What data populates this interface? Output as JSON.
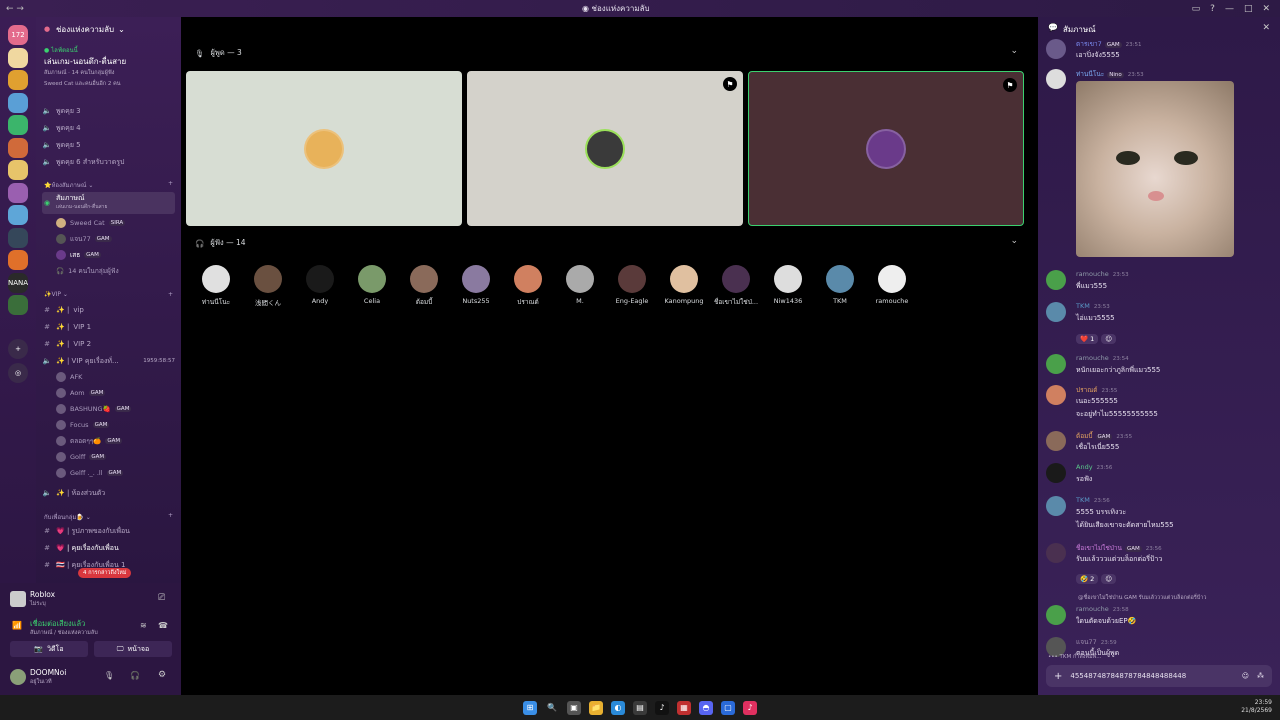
{
  "window": {
    "title": "ช่องแห่งความลับ",
    "nav": "← →",
    "controls": [
      "▭",
      "?",
      "—",
      "□",
      "✕"
    ]
  },
  "rail": {
    "servers": [
      {
        "label": "172",
        "color": "#e36b8c",
        "badge": "172"
      },
      {
        "label": "",
        "color": "#f0d8a0",
        "badge": ""
      },
      {
        "label": "",
        "color": "#e0a030",
        "badge": ""
      },
      {
        "label": "",
        "color": "#5a9fd6",
        "badge": "31"
      },
      {
        "label": "",
        "color": "#3bb56b",
        "badge": "69"
      },
      {
        "label": "",
        "color": "#d06a3a",
        "badge": "72"
      },
      {
        "label": "",
        "color": "#e7c46a",
        "badge": "24"
      },
      {
        "label": "",
        "color": "#9a5fb0",
        "badge": "4"
      },
      {
        "label": "",
        "color": "#5ea6d8",
        "badge": "1"
      },
      {
        "label": "",
        "color": "#35475a",
        "badge": "4"
      },
      {
        "label": "",
        "color": "#e0702a",
        "badge": ""
      },
      {
        "label": "NANA",
        "color": "#2a2a2a",
        "badge": ""
      },
      {
        "label": "",
        "color": "#3a6e3a",
        "badge": "96+"
      }
    ]
  },
  "sidebar": {
    "server_name": "ช่องแห่งความลับ",
    "event_label": "● ไลฟ์ตอนนี้",
    "event_title": "เล่นเกม-นอนดึก-ตื่นสาย",
    "event_sub1": "สัมภาษณ์ · 14 คนในกลุ่มผู้ฟัง",
    "event_sub2": "Sweed Cat และคนอื่นอีก 2 คน",
    "channels_top": [
      "พูดคุย 3",
      "พูดคุย 4",
      "พูดคุย 5",
      "พูดคุย 6 สำหรับวาดรูป"
    ],
    "cat_interview": "⭐ห้องสัมภาษณ์ ⌄",
    "stage_name": "สัมภาษณ์",
    "stage_sub": "เล่นเกม-นอนดึก-ตื่นสาย",
    "stage_users": [
      {
        "name": "Sweed Cat",
        "tag": "SIRA"
      },
      {
        "name": "แจน77",
        "tag": "GAM"
      },
      {
        "name": "เสธ",
        "tag": "GAM"
      }
    ],
    "audience_count": "14 คนในกลุ่มผู้ฟัง",
    "cat_vip": "✨VIP ⌄",
    "vip_channels": [
      "vip",
      "VIP 1",
      "VIP 2"
    ],
    "vip_voice": "✨ | VIP คุยเรื่องทั่...",
    "vip_timer": "1959:58:57",
    "vip_users": [
      {
        "name": "AFK",
        "tag": ""
      },
      {
        "name": "Aom",
        "tag": "GAM"
      },
      {
        "name": "BASHUNG🍓",
        "tag": "GAM"
      },
      {
        "name": "Focus",
        "tag": "GAM"
      },
      {
        "name": "ตลอดๆๆ🍊",
        "tag": "GAM"
      },
      {
        "name": "Golff",
        "tag": "GAM"
      },
      {
        "name": "Gelff ._. .ll",
        "tag": "GAM"
      }
    ],
    "private_room": "✨ | ห้องส่วนตัว",
    "cat_friends": "กับเพื่อนกลุ่ม🍺 ⌄",
    "friend_channels": [
      "💗 | รูปภาพของกับเพื่อน",
      "💗 | คุยเรื่องกับเพื่อน",
      "🇹🇭 | คุยเรื่องกับเพื่อน 1"
    ],
    "new_mentions": "4 การกล่าวถึงใหม่"
  },
  "user_panel": {
    "game": "Roblox",
    "game_sub": "ไม่ระบุ",
    "voice_status": "เชื่อมต่อเสียงแล้ว",
    "voice_sub": "สัมภาษณ์ / ช่องแห่งความลับ",
    "video_label": "วิดีโอ",
    "screen_label": "หน้าจอ",
    "username": "DOOMNoi",
    "user_status": "อยู่ในเวที"
  },
  "stage": {
    "speakers_label": "ผู้พูด — 3",
    "listeners_label": "ผู้ฟัง — 14",
    "speaker_tiles": [
      {
        "bg": "#d7ddd3",
        "avatar": "#e8b25a",
        "corner": false,
        "active": false
      },
      {
        "bg": "#d4d2cb",
        "avatar": "#3a3a3a",
        "corner": true,
        "active": false
      },
      {
        "bg": "#4a2f34",
        "avatar": "#6a3a8a",
        "corner": true,
        "active": true
      }
    ],
    "listeners": [
      {
        "name": "ท่านนีโนะ",
        "color": "#e0e0e0"
      },
      {
        "name": "浅間くん",
        "color": "#6a5040"
      },
      {
        "name": "Andy",
        "color": "#1a1a1a"
      },
      {
        "name": "Celia",
        "color": "#7a9a6a"
      },
      {
        "name": "ต้อมบี้",
        "color": "#8a6a5a"
      },
      {
        "name": "Nuts255",
        "color": "#8a7aa0"
      },
      {
        "name": "ปราณต์",
        "color": "#d08060"
      },
      {
        "name": "M.",
        "color": "#aaaaaa"
      },
      {
        "name": "Eng-Eagle",
        "color": "#5a3a3a"
      },
      {
        "name": "Kanompung",
        "color": "#e0c0a0"
      },
      {
        "name": "ชื่อเขาไม่ใช่ป่...",
        "color": "#4a3050"
      },
      {
        "name": "Niw1436",
        "color": "#dddddd"
      },
      {
        "name": "TKM",
        "color": "#5a8aaa"
      },
      {
        "name": "ramouche",
        "color": "#eeeeee"
      }
    ]
  },
  "chat": {
    "header": "สัมภาษณ์",
    "messages": [
      {
        "name": "ตารเขา7",
        "tag": "GAM",
        "time": "23:51",
        "text": "เอาปิ่งจัง5555",
        "color": "#7a8af0",
        "avatar": "#6a5a8a"
      },
      {
        "name": "ท่านนีโนะ",
        "tag": "Nino",
        "time": "23:53",
        "text": "",
        "color": "#7aa8f0",
        "avatar": "#dddddd"
      },
      {
        "name": "ramouche",
        "tag": "",
        "time": "23:53",
        "text": "พี่แมว555",
        "color": "#8e9aa8",
        "avatar": "#4aa04a"
      },
      {
        "name": "TKM",
        "tag": "",
        "time": "23:53",
        "text": "ไอ่แมว5555",
        "color": "#5a9ac8",
        "avatar": "#5a8aaa"
      },
      {
        "name": "ramouche",
        "tag": "",
        "time": "23:54",
        "text": "หนักเยอะกว่าภูลิกพี่แมว555",
        "color": "#8e9aa8",
        "avatar": "#4aa04a"
      },
      {
        "name": "ปราณต์",
        "tag": "",
        "time": "23:55",
        "text": "เนอะ555555",
        "text2": "จะอยู่ทำไม55555555555",
        "color": "#e0a060",
        "avatar": "#d08060"
      },
      {
        "name": "ต้อมบี้",
        "tag": "GAM",
        "time": "23:55",
        "text": "เชื่อไรเนี่ย555",
        "color": "#e0a060",
        "avatar": "#8a6a5a"
      },
      {
        "name": "Andy",
        "tag": "",
        "time": "23:56",
        "text": "รอฟัง",
        "color": "#5ac88a",
        "avatar": "#1a1a1a"
      },
      {
        "name": "TKM",
        "tag": "",
        "time": "23:56",
        "text": "5555 บรรเทิงวะ",
        "text2": "ได้ยินเสียงเขาจะตัดสายไหม555",
        "color": "#5a9ac8",
        "avatar": "#5a8aaa"
      },
      {
        "name": "ชื่อเขาไม่ใช่ป่าน",
        "tag": "GAM",
        "time": "23:56",
        "text": "รับมเล้วววแต่วบล็อกต่อรี่ป้าว",
        "color": "#c87ad8",
        "avatar": "#4a3050"
      },
      {
        "name": "ramouche",
        "tag": "",
        "time": "23:58",
        "text": "ใดนตัดจบด้วยEP🤣",
        "color": "#8e9aa8",
        "avatar": "#4aa04a"
      },
      {
        "name": "แจน77",
        "tag": "",
        "time": "23:59",
        "text": "ตอนนี้เป็นผู้พูด",
        "color": "#9a8cab",
        "avatar": "#555555"
      }
    ],
    "reactions_1": [
      {
        "emoji": "❤️",
        "count": "1"
      }
    ],
    "reactions_2": [
      {
        "emoji": "🤣",
        "count": "2"
      }
    ],
    "reply_preview": "@ชื่อเขาไม่ใช่ป่าน GAM รับมเล้วววแต่วบล็อกต่อรี่ป้าว",
    "typing": "TKM กำลังพิมพ์...",
    "input_value": "45548748784878784848488448"
  },
  "taskbar": {
    "time": "23:59",
    "date": "21/8/2569"
  }
}
